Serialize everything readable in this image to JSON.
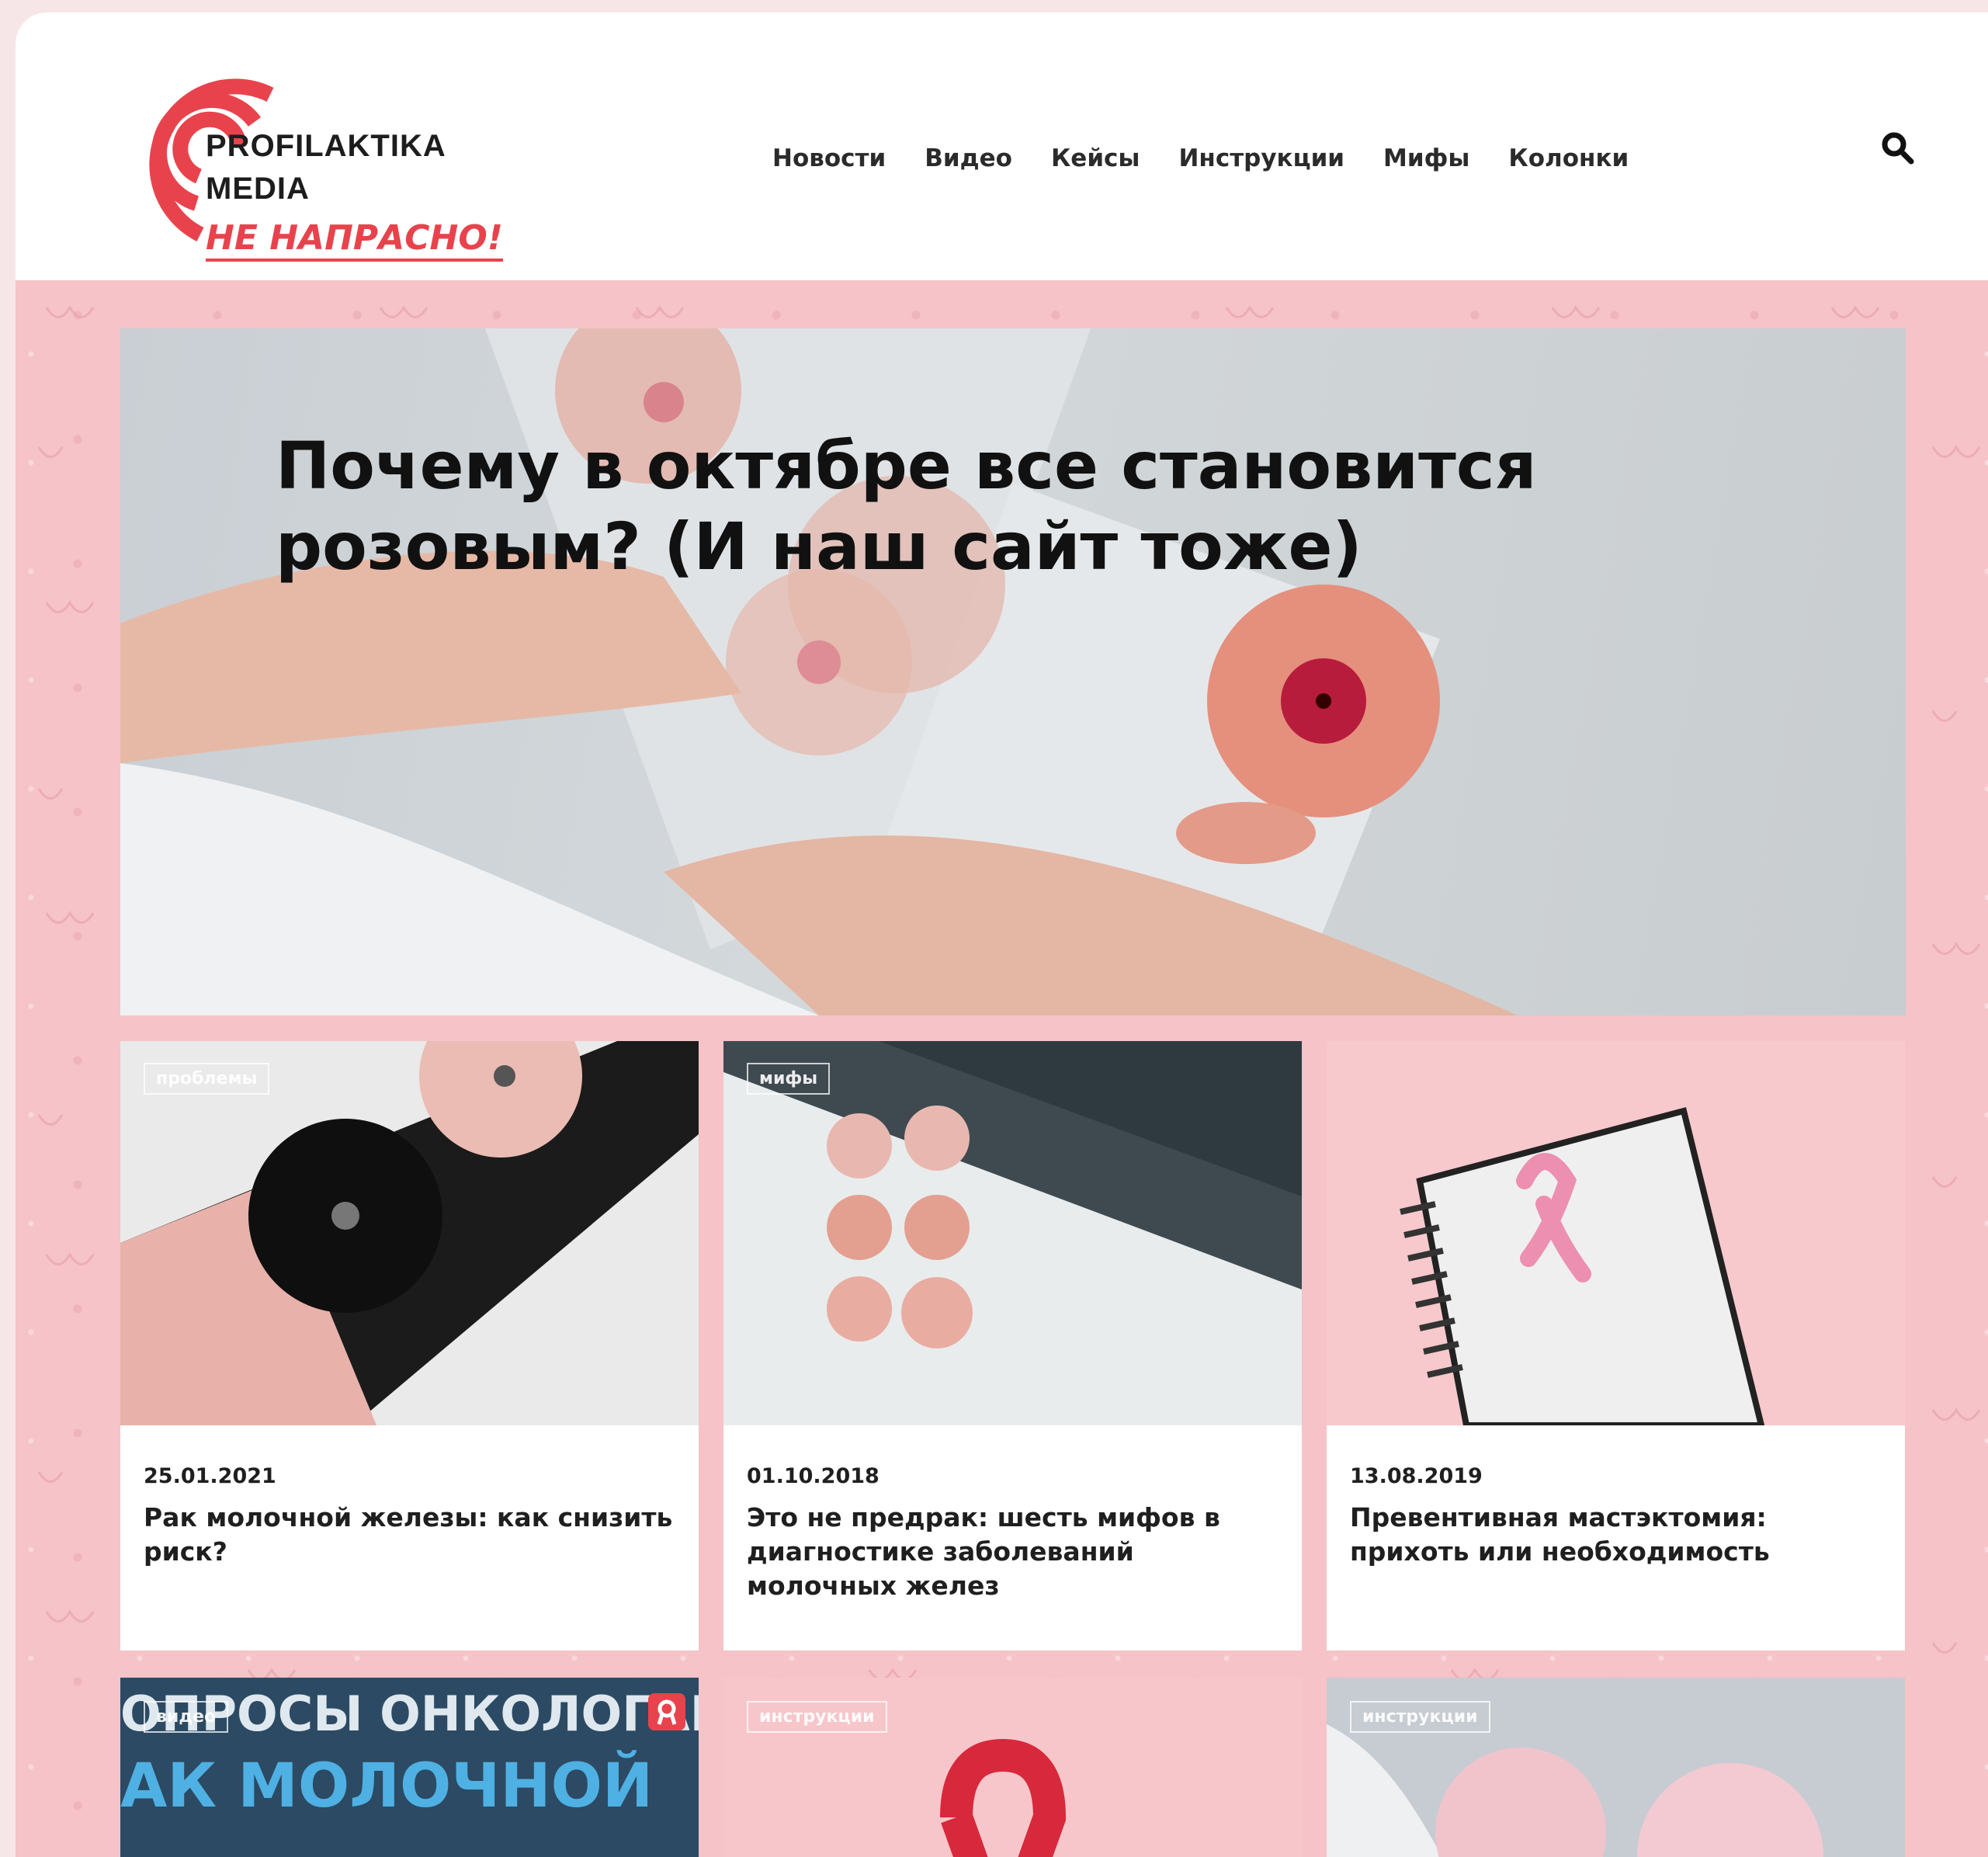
{
  "brand": {
    "line1": "PROFILAKTIKA",
    "line2": "MEDIA",
    "tagline": "НЕ НАПРАСНО!",
    "accent_color": "#e8434c"
  },
  "nav": {
    "items": [
      "Новости",
      "Видео",
      "Кейсы",
      "Инструкции",
      "Мифы",
      "Колонки"
    ],
    "search_icon": "search-icon"
  },
  "hero": {
    "title": "Почему в октябре все становится розовым? (И наш сайт тоже)"
  },
  "cards": [
    {
      "tag": "проблемы",
      "date": "25.01.2021",
      "title": "Рак молочной железы: как снизить риск?"
    },
    {
      "tag": "мифы",
      "date": "01.10.2018",
      "title": "Это не предрак: шесть мифов в диагностике заболеваний молочных желез"
    },
    {
      "tag": "",
      "date": "13.08.2019",
      "title": "Превентивная мастэктомия: прихоть или необходимость"
    }
  ],
  "cards_row2": [
    {
      "tag": "видео",
      "overlay_line1": "ОПРОСЫ ОНКОЛОГАМ",
      "overlay_line2": "АК МОЛОЧНОЙ"
    },
    {
      "tag": "инструкции"
    },
    {
      "tag": "инструкции"
    }
  ]
}
